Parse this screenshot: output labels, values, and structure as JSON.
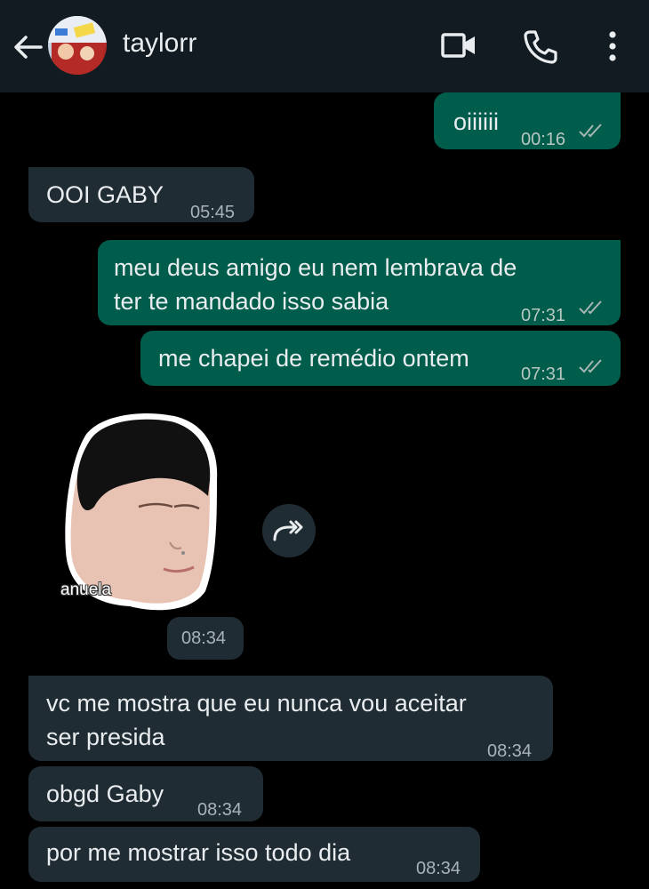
{
  "header": {
    "contact_name": "taylorr",
    "back_icon": "arrow-left-icon",
    "video_icon": "video-camera-icon",
    "call_icon": "phone-icon",
    "menu_icon": "more-vertical-icon"
  },
  "colors": {
    "background": "#000000",
    "header": "#111b21",
    "outgoing_bubble": "#005c4b",
    "incoming_bubble": "#202c33",
    "read_ticks": "#a6b6b2"
  },
  "messages": [
    {
      "direction": "out",
      "text": "oiiiiii",
      "time": "00:16",
      "status": "read"
    },
    {
      "direction": "in",
      "text": "OOI GABY",
      "time": "05:45"
    },
    {
      "direction": "out",
      "text": "meu deus amigo eu nem lembrava de\nter te mandado isso sabia",
      "time": "07:31",
      "status": "read"
    },
    {
      "direction": "out",
      "text": "me chapei de remédio ontem",
      "time": "07:31",
      "status": "read"
    },
    {
      "direction": "in",
      "type": "sticker",
      "sticker_label": "anuela",
      "time": "08:34"
    },
    {
      "direction": "in",
      "text": "vc me mostra que eu nunca vou aceitar\nser presida",
      "time": "08:34"
    },
    {
      "direction": "in",
      "text": "obgd Gaby",
      "time": "08:34"
    },
    {
      "direction": "in",
      "text": "por me mostrar isso todo dia",
      "time": "08:34"
    }
  ],
  "forward_icon": "forward-icon"
}
